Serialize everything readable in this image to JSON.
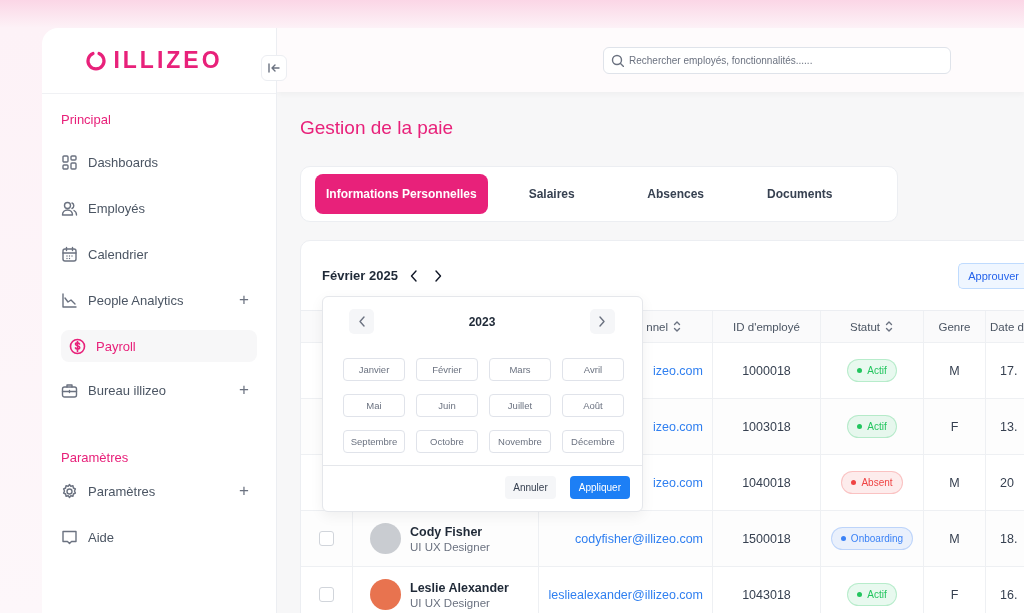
{
  "logo": {
    "text": "ILLIZEO"
  },
  "search": {
    "placeholder": "Rechercher employés, fonctionnalités......"
  },
  "sidebar": {
    "sections": [
      {
        "title": "Principal",
        "items": [
          {
            "label": "Dashboards",
            "selected": false
          },
          {
            "label": "Employés",
            "selected": false
          },
          {
            "label": "Calendrier",
            "selected": false
          },
          {
            "label": "People Analytics",
            "selected": false,
            "expand_sign": "+"
          },
          {
            "label": "Payroll",
            "selected": true
          },
          {
            "label": "Bureau illizeo",
            "selected": false,
            "expand_sign": "+"
          }
        ]
      },
      {
        "title": "Paramètres",
        "items": [
          {
            "label": "Paramètres",
            "selected": false,
            "expand_sign": "+"
          },
          {
            "label": "Aide",
            "selected": false
          }
        ]
      }
    ]
  },
  "page_title": "Gestion de la paie",
  "tabs": [
    {
      "label": "Informations Personnelles",
      "selected": true
    },
    {
      "label": "Salaires",
      "selected": false
    },
    {
      "label": "Absences",
      "selected": false
    },
    {
      "label": "Documents",
      "selected": false
    }
  ],
  "period": {
    "label": "Février 2025"
  },
  "approve_button": "Approuver",
  "table": {
    "columns": [
      {
        "label": "nnel",
        "sortable": true
      },
      {
        "label": "ID d'employé",
        "sortable": false
      },
      {
        "label": "Statut",
        "sortable": true
      },
      {
        "label": "Genre",
        "sortable": false
      },
      {
        "label": "Date d"
      }
    ],
    "rows": [
      {
        "email": "izeo.com",
        "id": "1000018",
        "status": "Actif",
        "color": "#22c55e",
        "gender": "M",
        "date": "17."
      },
      {
        "email": "izeo.com",
        "id": "1003018",
        "status": "Actif",
        "color": "#22c55e",
        "gender": "F",
        "date": "13."
      },
      {
        "email": "izeo.com",
        "id": "1040018",
        "status": "Absent",
        "color": "#ef4444",
        "gender": "M",
        "date": "20"
      },
      {
        "checked": false,
        "name": "Cody Fisher",
        "role": "UI UX Designer",
        "email": "codyfisher@illizeo.com",
        "id": "1500018",
        "status": "Onboarding",
        "color": "#3b82f6",
        "gender": "M",
        "date": "18."
      },
      {
        "checked": false,
        "name": "Leslie Alexander",
        "role": "UI UX Designer",
        "email": "lesliealexander@illizeo.com",
        "id": "1043018",
        "status": "Actif",
        "color": "#22c55e",
        "gender": "F",
        "date": "16."
      }
    ]
  },
  "month_picker": {
    "year": "2023",
    "months": [
      {
        "label": "Janvier",
        "selected": false
      },
      {
        "label": "Février",
        "selected": false
      },
      {
        "label": "Mars",
        "selected": false
      },
      {
        "label": "Avril",
        "selected": false
      },
      {
        "label": "Mai",
        "selected": false
      },
      {
        "label": "Juin",
        "selected": false
      },
      {
        "label": "Juillet",
        "selected": false
      },
      {
        "label": "Août",
        "selected": false
      },
      {
        "label": "Septembre",
        "selected": false
      },
      {
        "label": "Octobre",
        "selected": false
      },
      {
        "label": "Novembre",
        "selected": false
      },
      {
        "label": "Décembre",
        "selected": false
      }
    ],
    "cancel": "Annuler",
    "apply": "Appliquer"
  }
}
